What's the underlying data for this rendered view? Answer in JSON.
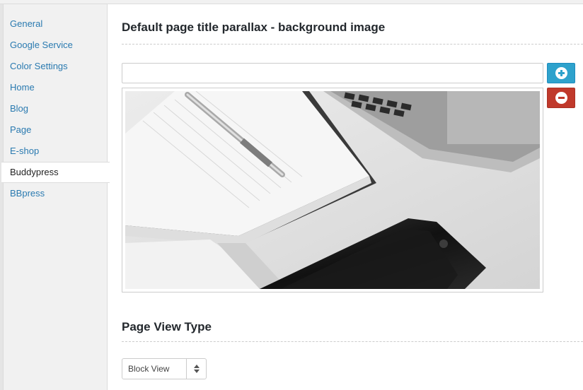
{
  "sidebar": {
    "items": [
      {
        "label": "General"
      },
      {
        "label": "Google Service"
      },
      {
        "label": "Color Settings"
      },
      {
        "label": "Home"
      },
      {
        "label": "Blog"
      },
      {
        "label": "Page"
      },
      {
        "label": "E-shop"
      },
      {
        "label": "Buddypress"
      },
      {
        "label": "BBpress"
      }
    ],
    "active_label": "Buddypress"
  },
  "main": {
    "background_section": {
      "title": "Default page title parallax - background image",
      "url_value": "",
      "add_icon": "plus-circle-icon",
      "remove_icon": "minus-circle-icon",
      "image_subject": "notebook-pen-laptop-phone-photo"
    },
    "view_section": {
      "title": "Page View Type",
      "select_value": "Block View"
    }
  },
  "colors": {
    "link": "#2a7ab0",
    "add_button": "#2ea2cc",
    "remove_button": "#c0392b",
    "sidebar_bg": "#f1f1f1"
  }
}
